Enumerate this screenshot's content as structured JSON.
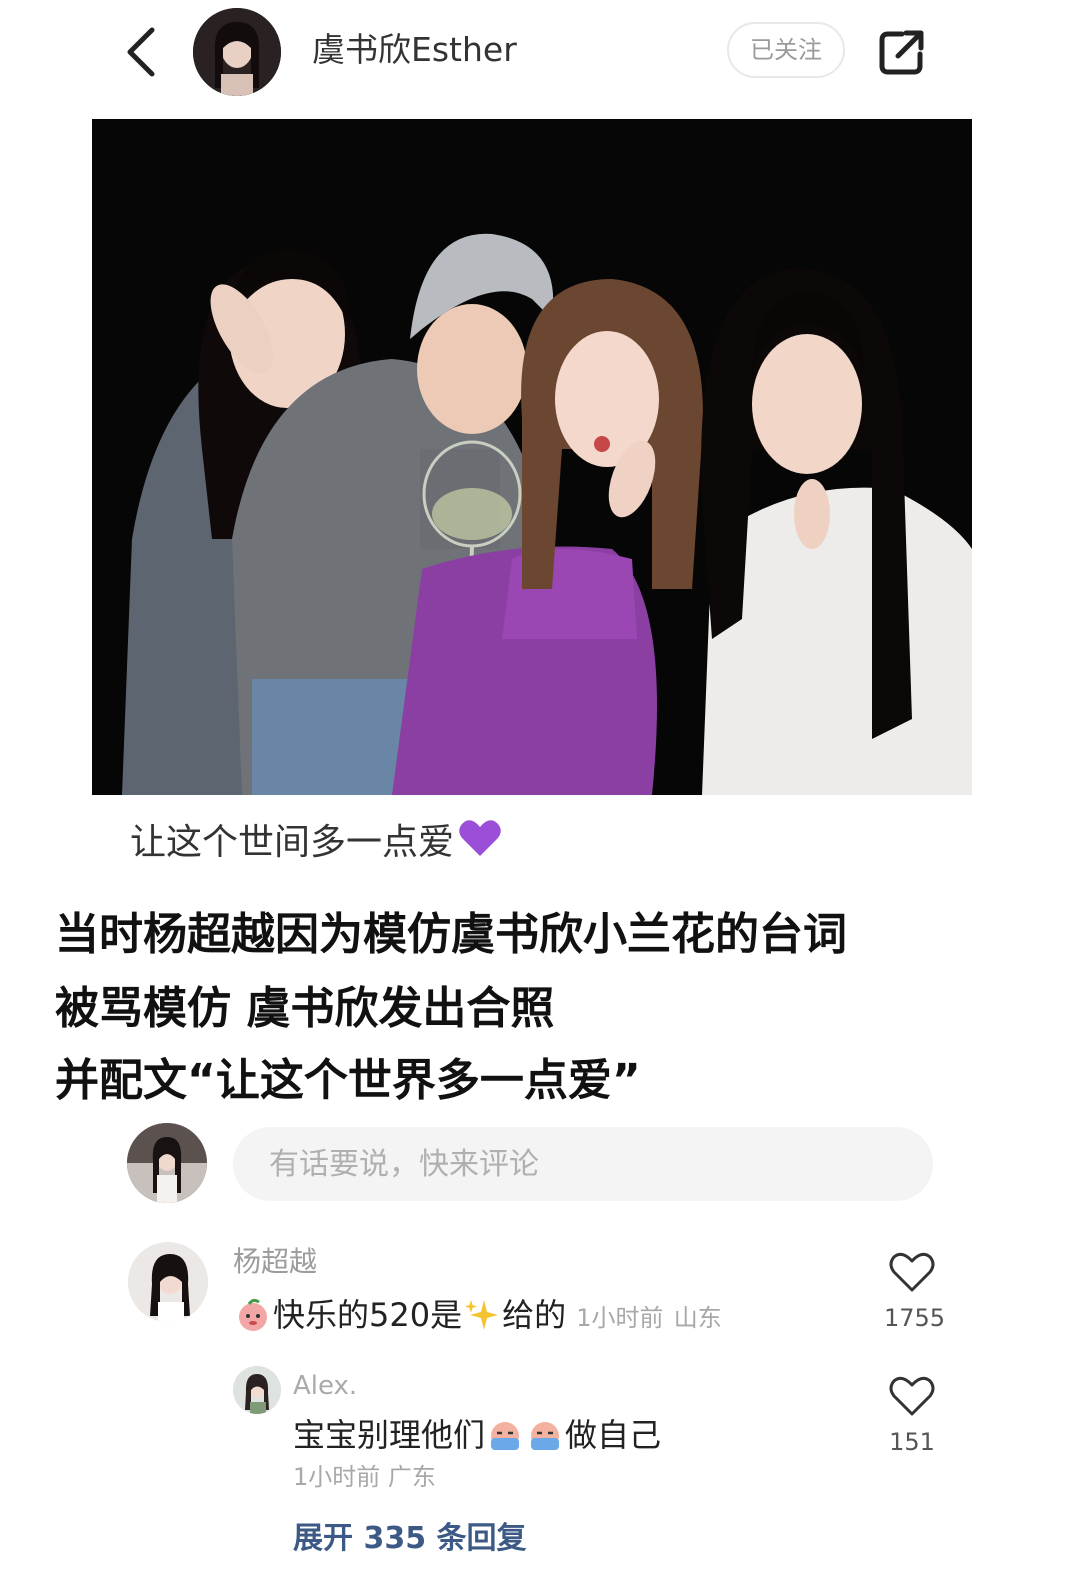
{
  "header": {
    "username": "虞书欣Esther",
    "follow_label": "已关注",
    "back_icon": "chevron-left-icon",
    "share_icon": "share-icon"
  },
  "post": {
    "caption": "让这个世间多一点爱",
    "caption_emoji": "purple-heart-icon"
  },
  "headline": {
    "lines": [
      "当时杨超越因为模仿虞书欣小兰花的台词",
      "被骂模仿 虞书欣发出合照",
      "并配文“让这个世界多一点爱”"
    ]
  },
  "comment_input": {
    "placeholder": "有话要说，快来评论"
  },
  "comments": [
    {
      "username": "杨超越",
      "text_before": "快乐的520是",
      "text_after": "给的",
      "time": "1小时前",
      "location": "山东",
      "likes": "1755"
    },
    {
      "username": "Alex.",
      "text_before": "宝宝别理他们",
      "text_after": "做自己",
      "time": "1小时前",
      "location": "广东",
      "likes": "151"
    }
  ],
  "expand_replies": "展开 335 条回复",
  "colors": {
    "purple_heart": "#9b4fd8",
    "link_blue": "#3d5a86"
  }
}
